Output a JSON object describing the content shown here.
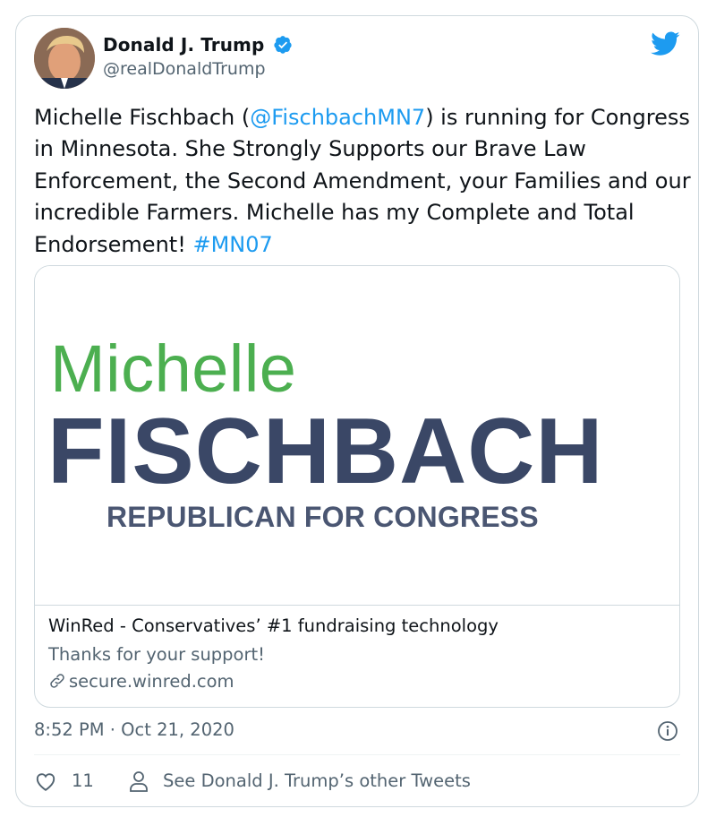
{
  "tweet": {
    "author_name": "Donald J. Trump",
    "author_handle": "@realDonaldTrump",
    "text_part1": "Michelle Fischbach (",
    "mention": "@FischbachMN7",
    "text_part2": ") is running for Congress in Minnesota. She Strongly Supports our Brave Law Enforcement, the Second Amendment, your Families and our incredible Farmers. Michelle has my Complete and Total Endorsement! ",
    "hashtag": "#MN07",
    "timestamp": "8:52 PM · Oct 21, 2020"
  },
  "link_card": {
    "image_text": {
      "first_name": "Michelle",
      "last_name": "FISCHBACH",
      "subtitle": "REPUBLICAN FOR CONGRESS"
    },
    "title": "WinRed - Conservatives’ #1 fundraising technology",
    "description": "Thanks for your support!",
    "url": "secure.winred.com"
  },
  "footer": {
    "like_count": "11",
    "other_tweets_label": "See Donald J. Trump’s other Tweets"
  },
  "colors": {
    "link_blue": "#1d9bf0",
    "logo_green": "#4caf50",
    "logo_navy": "#3a4766",
    "muted_text": "#536471"
  },
  "icons": [
    "twitter-bird-icon",
    "verified-badge-icon",
    "info-icon",
    "heart-icon",
    "person-icon",
    "link-icon"
  ]
}
